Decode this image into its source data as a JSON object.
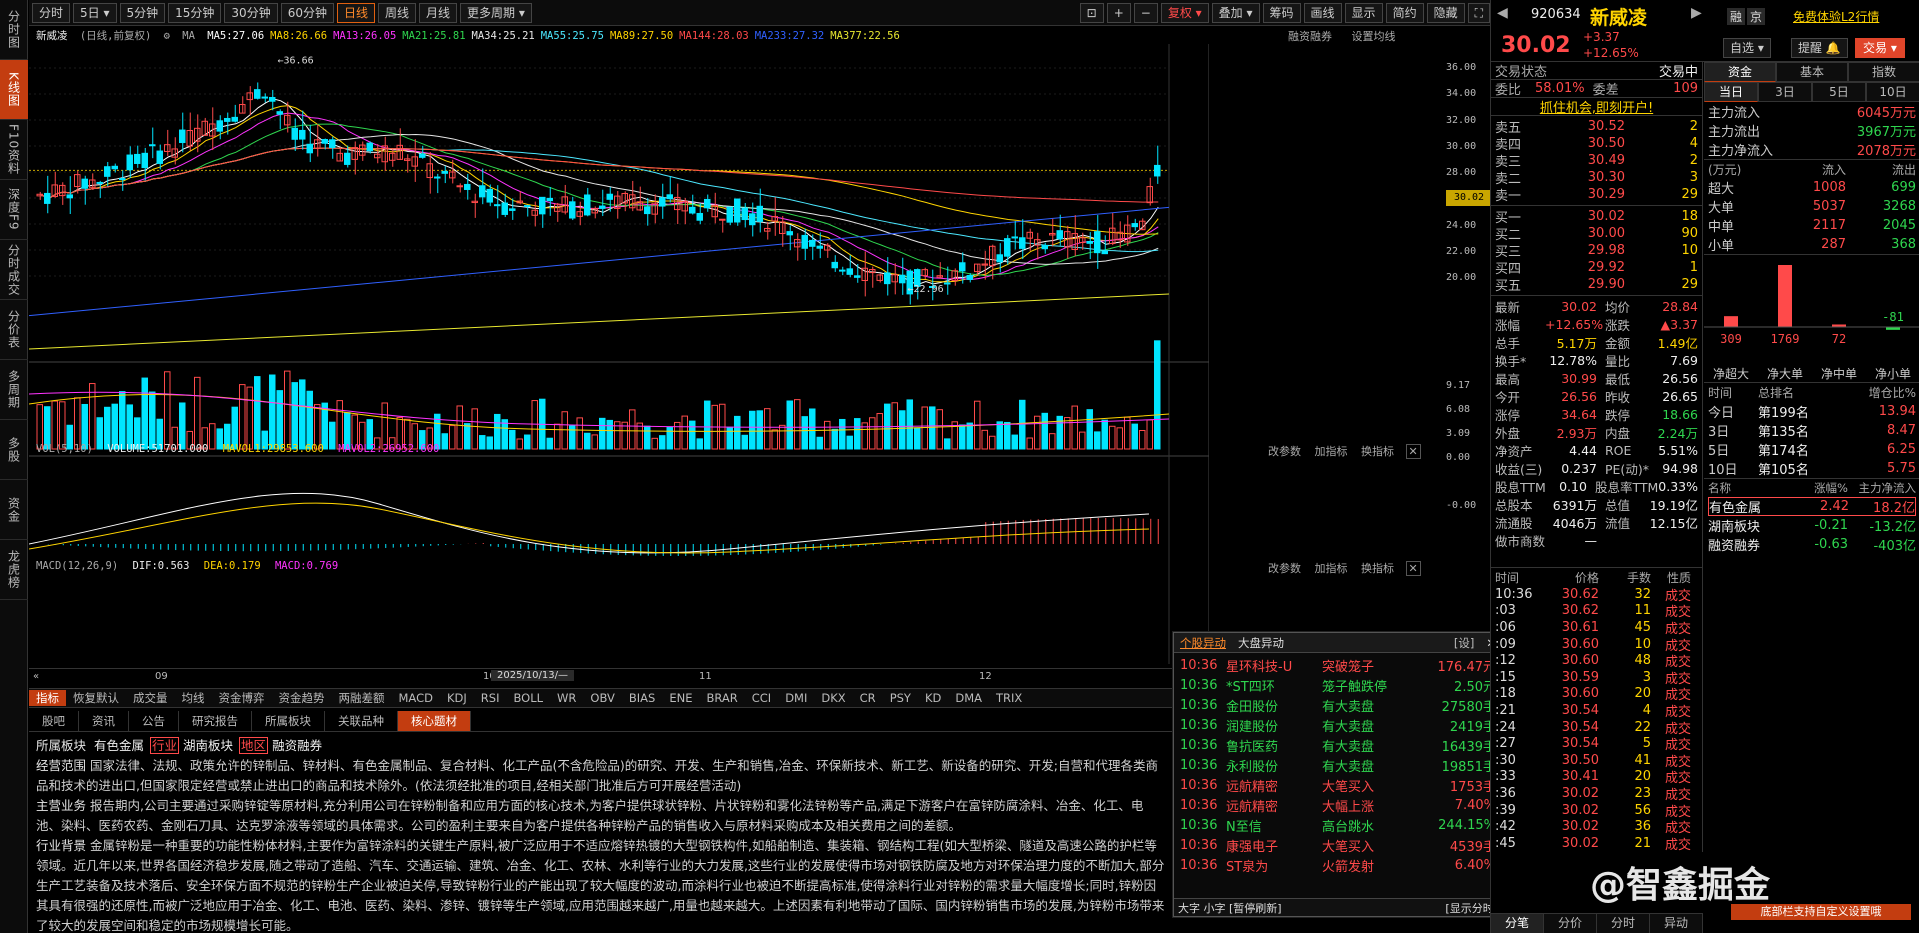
{
  "leftnav": [
    "分时图",
    "K线图",
    "F10资料",
    "深度F9",
    "分时成交",
    "分价表",
    "多周期",
    "多股",
    "资金",
    "龙虎榜"
  ],
  "toolbar": {
    "periods": [
      "分时",
      "5日",
      "5分钟",
      "15分钟",
      "30分钟",
      "60分钟",
      "日线",
      "周线",
      "月线",
      "更多周期"
    ],
    "active_period": "日线",
    "right_tools": [
      "复权",
      "叠加",
      "筹码",
      "画线",
      "显示",
      "简约",
      "隐藏"
    ],
    "active_tool": "复权"
  },
  "main_legend": {
    "title": "新威凌",
    "mode": "(日线,前复权)",
    "ma_label": "MA",
    "mas": [
      {
        "label": "MA5:27.06",
        "color": "#ffffff"
      },
      {
        "label": "MA8:26.66",
        "color": "#ffd400"
      },
      {
        "label": "MA13:26.05",
        "color": "#ff34ff"
      },
      {
        "label": "MA21:25.81",
        "color": "#2fd64f"
      },
      {
        "label": "MA34:25.21",
        "color": "#e6e6e6"
      },
      {
        "label": "MA55:25.75",
        "color": "#4ce8ff"
      },
      {
        "label": "MA89:27.50",
        "color": "#ffd400"
      },
      {
        "label": "MA144:28.03",
        "color": "#ff4a4a"
      },
      {
        "label": "MA233:27.32",
        "color": "#3060ff"
      },
      {
        "label": "MA377:22.56",
        "color": "#e8e830"
      }
    ],
    "right": [
      "融资融券",
      "设置均线"
    ]
  },
  "price_axis": [
    "36.00",
    "34.00",
    "32.00",
    "30.00",
    "28.00",
    "26.00",
    "24.00",
    "22.00",
    "20.00"
  ],
  "current_price_tag": "30.02",
  "annotations": {
    "high": "36.66",
    "low": "22.96"
  },
  "vol_panel": {
    "title": "VOL(5,10)",
    "volume": "VOLUME:51701.000",
    "mavol1": "MAVOL1:29853.600",
    "mavol2": "MAVOL2:26952.600",
    "axis": [
      "9.17",
      "6.08",
      "3.09",
      "0.00"
    ],
    "tools": [
      "改参数",
      "加指标",
      "换指标"
    ]
  },
  "macd_panel": {
    "title": "MACD(12,26,9)",
    "dif": "DIF:0.563",
    "dea": "DEA:0.179",
    "macd": "MACD:0.769",
    "axis": [
      "-0.00"
    ],
    "tools": [
      "改参数",
      "加指标",
      "换指标"
    ]
  },
  "xaxis": {
    "labels": [
      "09",
      "10",
      "11",
      "12"
    ],
    "cursor_date": "2025/10/13/—"
  },
  "indicator_tabs": [
    "指标",
    "恢复默认",
    "成交量",
    "均线",
    "资金博弈",
    "资金趋势",
    "两融差额",
    "MACD",
    "KDJ",
    "RSI",
    "BOLL",
    "WR",
    "OBV",
    "BIAS",
    "ENE",
    "BRAR",
    "CCI",
    "DMI",
    "DKX",
    "CR",
    "PSY",
    "KD",
    "DMA",
    "TRIX"
  ],
  "info_tabs": [
    "股吧",
    "资讯",
    "公告",
    "研究报告",
    "所属板块",
    "关联品种",
    "核心题材"
  ],
  "active_info_tab": "核心题材",
  "info": {
    "sector_label": "所属板块",
    "sectors": [
      {
        "name": "有色金属",
        "tag": "行业"
      },
      {
        "name": "湖南板块",
        "tag": "地区"
      },
      {
        "name": "融资融券",
        "tag": ""
      }
    ],
    "scope_label": "经营范围",
    "scope": "国家法律、法规、政策允许的锌制品、锌材料、有色金属制品、复合材料、化工产品(不含危险品)的研究、开发、生产和销售,冶金、环保新技术、新工艺、新设备的研究、开发;自营和代理各类商品和技术的进出口,但国家限定经营或禁止进出口的商品和技术除外。(依法须经批准的项目,经相关部门批准后方可开展经营活动)",
    "biz_label": "主营业务",
    "biz": "报告期内,公司主要通过采购锌锭等原材料,充分利用公司在锌粉制备和应用方面的核心技术,为客户提供球状锌粉、片状锌粉和雾化法锌粉等产品,满足下游客户在富锌防腐涂料、冶金、化工、电池、染料、医药农药、金刚石刀具、达克罗涂液等领域的具体需求。公司的盈利主要来自为客户提供各种锌粉产品的销售收入与原材料采购成本及相关费用之间的差额。",
    "bg_label": "行业背景",
    "bg": "金属锌粉是一种重要的功能性粉体材料,主要作为富锌涂料的关键生产原料,被广泛应用于不适应熔锌热镀的大型钢铁构件,如船舶制造、集装箱、钢结构工程(如大型桥梁、隧道及高速公路的护栏等领域。近几年以来,世界各国经济稳步发展,随之带动了造船、汽车、交通运输、建筑、冶金、化工、农林、水利等行业的大力发展,这些行业的发展使得市场对钢铁防腐及地方对环保治理力度的不断加大,部分生产工艺装备及技术落后、安全环保方面不规范的锌粉生产企业被迫关停,导致锌粉行业的产能出现了较大幅度的波动,而涂料行业也被迫不断提高标准,使得涂料行业对锌粉的需求量大幅度增长;同时,锌粉因其具有很强的还原性,而被广泛地应用于冶金、化工、电池、医药、染料、渗锌、镀锌等生产领域,应用范围越来越广,用量也越来越大。上述因素有利地带动了国际、国内锌粉销售市场的发展,为锌粉市场带来了较大的发展空间和稳定的市场规模增长可能。"
  },
  "popup": {
    "tabs": [
      "个股异动",
      "大盘异动"
    ],
    "settings": "[设]",
    "rows": [
      {
        "t": "10:36",
        "n": "星环科技-U",
        "e": "突破笼子",
        "v": "176.47元",
        "c": "red"
      },
      {
        "t": "10:36",
        "n": "*ST四环",
        "e": "笼子触跌停",
        "v": "2.50元",
        "c": "green"
      },
      {
        "t": "10:36",
        "n": "金田股份",
        "e": "有大卖盘",
        "v": "27580手",
        "c": "green"
      },
      {
        "t": "10:36",
        "n": "润建股份",
        "e": "有大卖盘",
        "v": "2419手",
        "c": "green"
      },
      {
        "t": "10:36",
        "n": "鲁抗医药",
        "e": "有大卖盘",
        "v": "16439手",
        "c": "green"
      },
      {
        "t": "10:36",
        "n": "永利股份",
        "e": "有大卖盘",
        "v": "19851手",
        "c": "green"
      },
      {
        "t": "10:36",
        "n": "远航精密",
        "e": "大笔买入",
        "v": "1753手",
        "c": "red"
      },
      {
        "t": "10:36",
        "n": "远航精密",
        "e": "大幅上涨",
        "v": "7.40%",
        "c": "red"
      },
      {
        "t": "10:36",
        "n": "N至信",
        "e": "高台跳水",
        "v": "244.15%",
        "c": "green"
      },
      {
        "t": "10:36",
        "n": "康强电子",
        "e": "大笔买入",
        "v": "4539手",
        "c": "red"
      },
      {
        "t": "10:36",
        "n": "ST泉为",
        "e": "火箭发射",
        "v": "6.40%",
        "c": "red"
      }
    ],
    "foot_left": "大字 小字 [暂停刷新]",
    "foot_right": "[显示分时]"
  },
  "quote": {
    "code": "920634",
    "name": "新威凌",
    "price": "30.02",
    "change": "+3.37",
    "pct": "+12.65%",
    "btn_zixuan": "自选",
    "btn_tixing": "提醒",
    "btn_trade": "交易",
    "badges": [
      "融",
      "京"
    ],
    "trial": "免费体验L2行情",
    "status_label": "交易状态",
    "status": "交易中",
    "weibi_label": "委比",
    "weibi": "58.01%",
    "weicha_label": "委差",
    "weicha": "109",
    "promo": "抓住机会,即刻开户!"
  },
  "orderbook": {
    "sells": [
      [
        "卖五",
        "30.52",
        "2"
      ],
      [
        "卖四",
        "30.50",
        "4"
      ],
      [
        "卖三",
        "30.49",
        "2"
      ],
      [
        "卖二",
        "30.30",
        "3"
      ],
      [
        "卖一",
        "30.29",
        "29"
      ]
    ],
    "buys": [
      [
        "买一",
        "30.02",
        "18"
      ],
      [
        "买二",
        "30.00",
        "90"
      ],
      [
        "买三",
        "29.98",
        "10"
      ],
      [
        "买四",
        "29.92",
        "1"
      ],
      [
        "买五",
        "29.90",
        "29"
      ]
    ]
  },
  "stats": [
    [
      "最新",
      "30.02",
      "均价",
      "28.84"
    ],
    [
      "涨幅",
      "+12.65%",
      "涨跌",
      "▲3.37"
    ],
    [
      "总手",
      "5.17万",
      "金额",
      "1.49亿"
    ],
    [
      "换手*",
      "12.78%",
      "量比",
      "7.69"
    ],
    [
      "最高",
      "30.99",
      "最低",
      "26.56"
    ],
    [
      "今开",
      "26.56",
      "昨收",
      "26.65"
    ],
    [
      "涨停",
      "34.64",
      "跌停",
      "18.66"
    ],
    [
      "外盘",
      "2.93万",
      "内盘",
      "2.24万"
    ],
    [
      "净资产",
      "4.44",
      "ROE",
      "5.51%"
    ],
    [
      "收益(三)",
      "0.237",
      "PE(动)*",
      "94.98"
    ],
    [
      "股息TTM",
      "0.10",
      "股息率TTM",
      "0.33%"
    ],
    [
      "总股本",
      "6391万",
      "总值",
      "19.19亿"
    ],
    [
      "流通股",
      "4046万",
      "流值",
      "12.15亿"
    ],
    [
      "做市商数",
      "—",
      "",
      ""
    ]
  ],
  "ticks": {
    "headers": [
      "时间",
      "价格",
      "手数",
      "性质"
    ],
    "rows": [
      [
        "10:36",
        "30.62",
        "32",
        "成交",
        "red"
      ],
      [
        ":03",
        "30.62",
        "11",
        "成交",
        "red"
      ],
      [
        ":06",
        "30.61",
        "45",
        "成交",
        "red"
      ],
      [
        ":09",
        "30.60",
        "10",
        "成交",
        "red"
      ],
      [
        ":12",
        "30.60",
        "48",
        "成交",
        "red"
      ],
      [
        ":15",
        "30.59",
        "3",
        "成交",
        "red"
      ],
      [
        ":18",
        "30.60",
        "20",
        "成交",
        "red"
      ],
      [
        ":21",
        "30.54",
        "4",
        "成交",
        "red"
      ],
      [
        ":24",
        "30.54",
        "22",
        "成交",
        "red"
      ],
      [
        ":27",
        "30.54",
        "5",
        "成交",
        "red"
      ],
      [
        ":30",
        "30.50",
        "41",
        "成交",
        "red"
      ],
      [
        ":33",
        "30.41",
        "20",
        "成交",
        "red"
      ],
      [
        ":36",
        "30.02",
        "23",
        "成交",
        "red"
      ],
      [
        ":39",
        "30.02",
        "56",
        "成交",
        "red"
      ],
      [
        ":42",
        "30.02",
        "36",
        "成交",
        "red"
      ],
      [
        ":45",
        "30.02",
        "21",
        "成交",
        "red"
      ]
    ]
  },
  "bottom_tabs": [
    "分笔",
    "分价",
    "分时",
    "异动"
  ],
  "capital": {
    "tabs": [
      "资金",
      "基本",
      "指数"
    ],
    "periods": [
      "当日",
      "3日",
      "5日",
      "10日"
    ],
    "main": [
      [
        "主力流入",
        "6045万元",
        "red"
      ],
      [
        "主力流出",
        "3967万元",
        "green"
      ],
      [
        "主力净流入",
        "2078万元",
        "red"
      ]
    ],
    "unit": "(万元)",
    "flow_headers": [
      "流入",
      "流出"
    ],
    "flows": [
      [
        "超大",
        "1008",
        "699"
      ],
      [
        "大单",
        "5037",
        "3268"
      ],
      [
        "中单",
        "2117",
        "2045"
      ],
      [
        "小单",
        "287",
        "368"
      ]
    ],
    "net_values": [
      309,
      1769,
      72,
      -81
    ],
    "net_labels": [
      "净超大",
      "净大单",
      "净中单",
      "净小单"
    ],
    "rank_headers": [
      "时间",
      "总排名",
      "增仓比%"
    ],
    "ranks": [
      [
        "今日",
        "第199名",
        "13.94"
      ],
      [
        "3日",
        "第135名",
        "8.47"
      ],
      [
        "5日",
        "第174名",
        "6.25"
      ],
      [
        "10日",
        "第105名",
        "5.75"
      ]
    ],
    "sector_headers": [
      "名称",
      "涨幅%",
      "主力净流入"
    ],
    "sectors": [
      [
        "有色金属",
        "2.42",
        "18.2亿",
        "red"
      ],
      [
        "湖南板块",
        "-0.21",
        "-13.2亿",
        "green"
      ],
      [
        "融资融券",
        "-0.63",
        "-403亿",
        "green"
      ]
    ]
  },
  "footer_banner": "底部栏支持自定义设置哦",
  "watermark": "@智鑫掘金",
  "colors": {
    "up": "#ff4a4a",
    "down": "#00e5ff",
    "accent": "#c33d10"
  }
}
